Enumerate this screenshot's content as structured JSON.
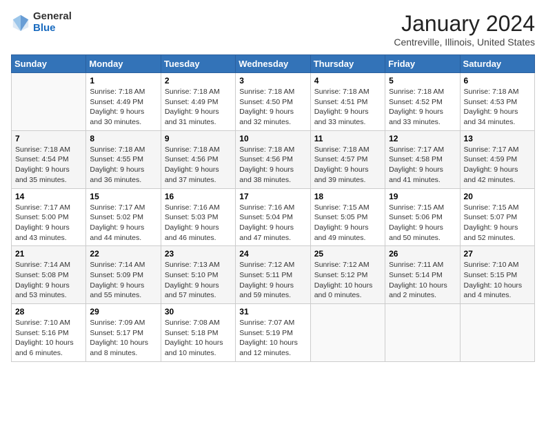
{
  "header": {
    "logo_general": "General",
    "logo_blue": "Blue",
    "title": "January 2024",
    "subtitle": "Centreville, Illinois, United States"
  },
  "days_of_week": [
    "Sunday",
    "Monday",
    "Tuesday",
    "Wednesday",
    "Thursday",
    "Friday",
    "Saturday"
  ],
  "weeks": [
    [
      {
        "day": "",
        "info": ""
      },
      {
        "day": "1",
        "info": "Sunrise: 7:18 AM\nSunset: 4:49 PM\nDaylight: 9 hours\nand 30 minutes."
      },
      {
        "day": "2",
        "info": "Sunrise: 7:18 AM\nSunset: 4:49 PM\nDaylight: 9 hours\nand 31 minutes."
      },
      {
        "day": "3",
        "info": "Sunrise: 7:18 AM\nSunset: 4:50 PM\nDaylight: 9 hours\nand 32 minutes."
      },
      {
        "day": "4",
        "info": "Sunrise: 7:18 AM\nSunset: 4:51 PM\nDaylight: 9 hours\nand 33 minutes."
      },
      {
        "day": "5",
        "info": "Sunrise: 7:18 AM\nSunset: 4:52 PM\nDaylight: 9 hours\nand 33 minutes."
      },
      {
        "day": "6",
        "info": "Sunrise: 7:18 AM\nSunset: 4:53 PM\nDaylight: 9 hours\nand 34 minutes."
      }
    ],
    [
      {
        "day": "7",
        "info": "Sunrise: 7:18 AM\nSunset: 4:54 PM\nDaylight: 9 hours\nand 35 minutes."
      },
      {
        "day": "8",
        "info": "Sunrise: 7:18 AM\nSunset: 4:55 PM\nDaylight: 9 hours\nand 36 minutes."
      },
      {
        "day": "9",
        "info": "Sunrise: 7:18 AM\nSunset: 4:56 PM\nDaylight: 9 hours\nand 37 minutes."
      },
      {
        "day": "10",
        "info": "Sunrise: 7:18 AM\nSunset: 4:56 PM\nDaylight: 9 hours\nand 38 minutes."
      },
      {
        "day": "11",
        "info": "Sunrise: 7:18 AM\nSunset: 4:57 PM\nDaylight: 9 hours\nand 39 minutes."
      },
      {
        "day": "12",
        "info": "Sunrise: 7:17 AM\nSunset: 4:58 PM\nDaylight: 9 hours\nand 41 minutes."
      },
      {
        "day": "13",
        "info": "Sunrise: 7:17 AM\nSunset: 4:59 PM\nDaylight: 9 hours\nand 42 minutes."
      }
    ],
    [
      {
        "day": "14",
        "info": "Sunrise: 7:17 AM\nSunset: 5:00 PM\nDaylight: 9 hours\nand 43 minutes."
      },
      {
        "day": "15",
        "info": "Sunrise: 7:17 AM\nSunset: 5:02 PM\nDaylight: 9 hours\nand 44 minutes."
      },
      {
        "day": "16",
        "info": "Sunrise: 7:16 AM\nSunset: 5:03 PM\nDaylight: 9 hours\nand 46 minutes."
      },
      {
        "day": "17",
        "info": "Sunrise: 7:16 AM\nSunset: 5:04 PM\nDaylight: 9 hours\nand 47 minutes."
      },
      {
        "day": "18",
        "info": "Sunrise: 7:15 AM\nSunset: 5:05 PM\nDaylight: 9 hours\nand 49 minutes."
      },
      {
        "day": "19",
        "info": "Sunrise: 7:15 AM\nSunset: 5:06 PM\nDaylight: 9 hours\nand 50 minutes."
      },
      {
        "day": "20",
        "info": "Sunrise: 7:15 AM\nSunset: 5:07 PM\nDaylight: 9 hours\nand 52 minutes."
      }
    ],
    [
      {
        "day": "21",
        "info": "Sunrise: 7:14 AM\nSunset: 5:08 PM\nDaylight: 9 hours\nand 53 minutes."
      },
      {
        "day": "22",
        "info": "Sunrise: 7:14 AM\nSunset: 5:09 PM\nDaylight: 9 hours\nand 55 minutes."
      },
      {
        "day": "23",
        "info": "Sunrise: 7:13 AM\nSunset: 5:10 PM\nDaylight: 9 hours\nand 57 minutes."
      },
      {
        "day": "24",
        "info": "Sunrise: 7:12 AM\nSunset: 5:11 PM\nDaylight: 9 hours\nand 59 minutes."
      },
      {
        "day": "25",
        "info": "Sunrise: 7:12 AM\nSunset: 5:12 PM\nDaylight: 10 hours\nand 0 minutes."
      },
      {
        "day": "26",
        "info": "Sunrise: 7:11 AM\nSunset: 5:14 PM\nDaylight: 10 hours\nand 2 minutes."
      },
      {
        "day": "27",
        "info": "Sunrise: 7:10 AM\nSunset: 5:15 PM\nDaylight: 10 hours\nand 4 minutes."
      }
    ],
    [
      {
        "day": "28",
        "info": "Sunrise: 7:10 AM\nSunset: 5:16 PM\nDaylight: 10 hours\nand 6 minutes."
      },
      {
        "day": "29",
        "info": "Sunrise: 7:09 AM\nSunset: 5:17 PM\nDaylight: 10 hours\nand 8 minutes."
      },
      {
        "day": "30",
        "info": "Sunrise: 7:08 AM\nSunset: 5:18 PM\nDaylight: 10 hours\nand 10 minutes."
      },
      {
        "day": "31",
        "info": "Sunrise: 7:07 AM\nSunset: 5:19 PM\nDaylight: 10 hours\nand 12 minutes."
      },
      {
        "day": "",
        "info": ""
      },
      {
        "day": "",
        "info": ""
      },
      {
        "day": "",
        "info": ""
      }
    ]
  ]
}
